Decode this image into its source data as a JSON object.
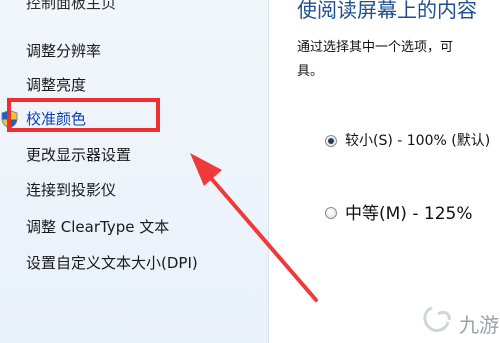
{
  "left_panel": {
    "top_cut_label": "控制面板主页",
    "links": [
      {
        "label": "调整分辨率"
      },
      {
        "label": "调整亮度"
      },
      {
        "label": "校准颜色"
      },
      {
        "label": "更改显示器设置"
      },
      {
        "label": "连接到投影仪"
      },
      {
        "label": "调整 ClearType 文本"
      },
      {
        "label": "设置自定义文本大小(DPI)"
      }
    ]
  },
  "right_panel": {
    "title": "使阅读屏幕上的内容",
    "description": "通过选择其中一个选项，可\n具。",
    "options": [
      {
        "label": "较小(S) - 100% (默认)",
        "selected": true
      },
      {
        "label": "中等(M) - 125%",
        "selected": false
      }
    ]
  },
  "annotation": {
    "highlight_color": "#ee2f2f"
  },
  "watermark": {
    "text": "九游"
  }
}
